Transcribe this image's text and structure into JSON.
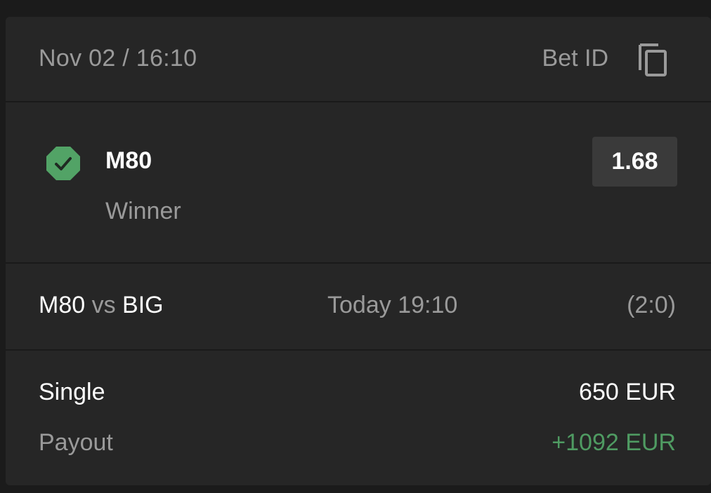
{
  "header": {
    "datetime": "Nov 02 / 16:10",
    "bet_id_label": "Bet ID",
    "copy_icon": "copy-icon"
  },
  "selection": {
    "status_icon": "check-octagon-icon",
    "status_color": "#52a366",
    "team": "M80",
    "market": "Winner",
    "odds": "1.68"
  },
  "match": {
    "home": "M80",
    "vs": "vs",
    "away": "BIG",
    "time": "Today 19:10",
    "score": "(2:0)"
  },
  "summary": {
    "bet_type": "Single",
    "stake": "650 EUR",
    "payout_label": "Payout",
    "payout_value": "+1092 EUR",
    "payout_color": "#4f9b62"
  }
}
